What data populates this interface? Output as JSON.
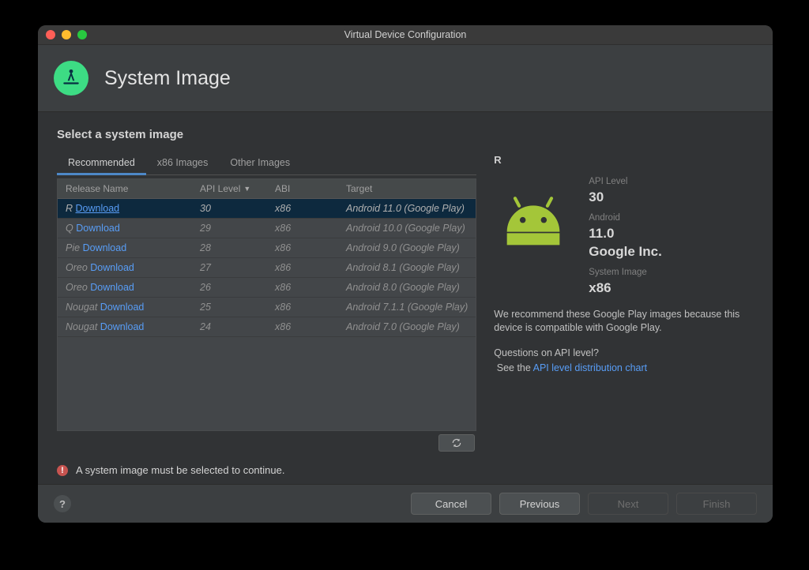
{
  "window": {
    "title": "Virtual Device Configuration"
  },
  "header": {
    "title": "System Image"
  },
  "main": {
    "subtitle": "Select a system image",
    "tabs": [
      {
        "label": "Recommended",
        "active": true
      },
      {
        "label": "x86 Images",
        "active": false
      },
      {
        "label": "Other Images",
        "active": false
      }
    ],
    "columns": {
      "release": "Release Name",
      "api": "API Level",
      "abi": "ABI",
      "target": "Target"
    },
    "download_label": "Download",
    "rows": [
      {
        "name": "R",
        "api": "30",
        "abi": "x86",
        "target": "Android 11.0 (Google Play)",
        "selected": true
      },
      {
        "name": "Q",
        "api": "29",
        "abi": "x86",
        "target": "Android 10.0 (Google Play)",
        "selected": false
      },
      {
        "name": "Pie",
        "api": "28",
        "abi": "x86",
        "target": "Android 9.0 (Google Play)",
        "selected": false
      },
      {
        "name": "Oreo",
        "api": "27",
        "abi": "x86",
        "target": "Android 8.1 (Google Play)",
        "selected": false
      },
      {
        "name": "Oreo",
        "api": "26",
        "abi": "x86",
        "target": "Android 8.0 (Google Play)",
        "selected": false
      },
      {
        "name": "Nougat",
        "api": "25",
        "abi": "x86",
        "target": "Android 7.1.1 (Google Play)",
        "selected": false
      },
      {
        "name": "Nougat",
        "api": "24",
        "abi": "x86",
        "target": "Android 7.0 (Google Play)",
        "selected": false
      }
    ],
    "error": "A system image must be selected to continue."
  },
  "details": {
    "name": "R",
    "api_label": "API Level",
    "api_value": "30",
    "android_label": "Android",
    "android_value": "11.0",
    "vendor": "Google Inc.",
    "sysimg_label": "System Image",
    "sysimg_value": "x86",
    "recommendation": "We recommend these Google Play images because this device is compatible with Google Play.",
    "question": "Questions on API level?",
    "link_prefix": "See the ",
    "link_text": "API level distribution chart"
  },
  "footer": {
    "help": "?",
    "cancel": "Cancel",
    "previous": "Previous",
    "next": "Next",
    "finish": "Finish"
  },
  "colors": {
    "accent_green": "#3ddc84",
    "link": "#589df6",
    "error": "#c75450",
    "android_robot": "#a4c639"
  }
}
